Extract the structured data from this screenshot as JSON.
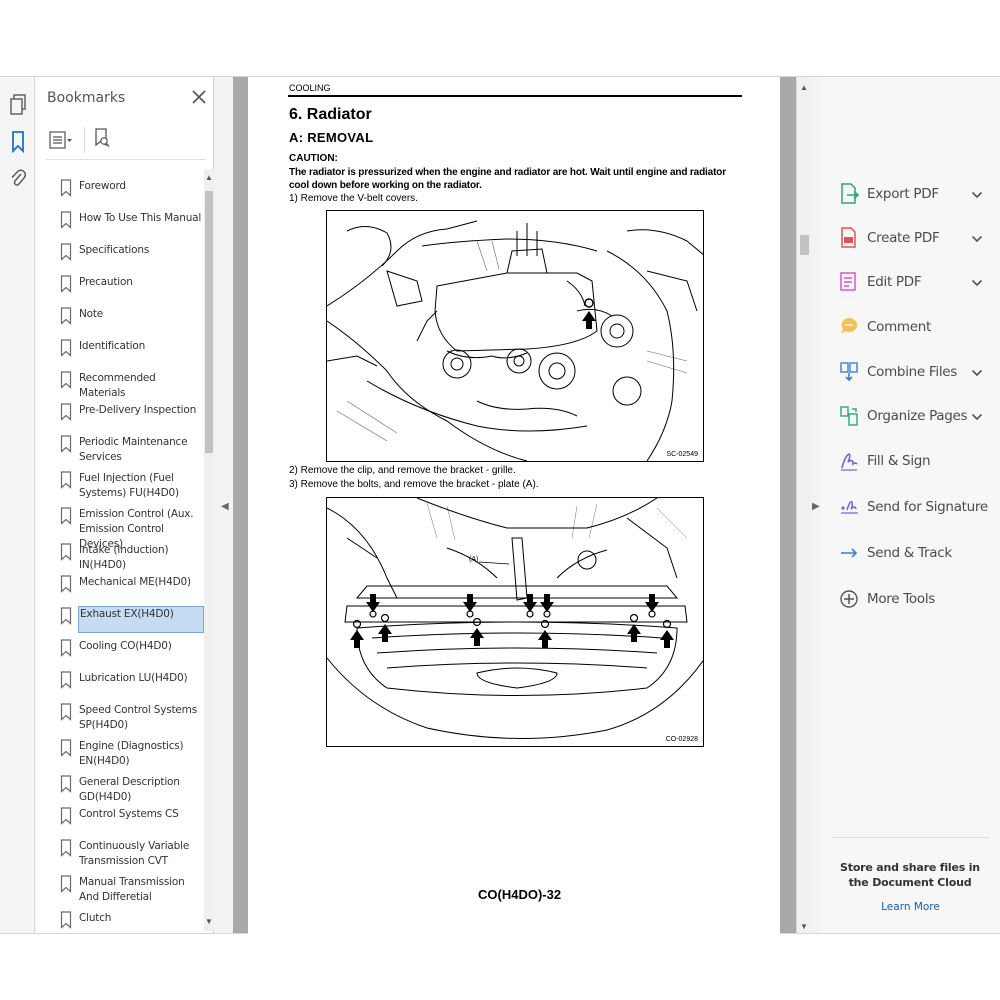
{
  "bookmarks_panel": {
    "title": "Bookmarks",
    "items": [
      {
        "label": "Foreword",
        "selected": false
      },
      {
        "label": "How To Use This Manual",
        "selected": false
      },
      {
        "label": "Specifications",
        "selected": false
      },
      {
        "label": "Precaution",
        "selected": false
      },
      {
        "label": "Note",
        "selected": false
      },
      {
        "label": "Identification",
        "selected": false
      },
      {
        "label": "Recommended Materials",
        "selected": false
      },
      {
        "label": "Pre-Delivery Inspection",
        "selected": false
      },
      {
        "label": "Periodic Maintenance Services",
        "selected": false
      },
      {
        "label": "Fuel Injection (Fuel Systems) FU(H4D0)",
        "selected": false
      },
      {
        "label": "Emission Control (Aux. Emission Control Devices)",
        "selected": false
      },
      {
        "label": "Intake (Induction) IN(H4D0)",
        "selected": false
      },
      {
        "label": "Mechanical ME(H4D0)",
        "selected": false
      },
      {
        "label": "Exhaust EX(H4D0)",
        "selected": true
      },
      {
        "label": "Cooling CO(H4D0)",
        "selected": false
      },
      {
        "label": "Lubrication LU(H4D0)",
        "selected": false
      },
      {
        "label": "Speed Control Systems SP(H4D0)",
        "selected": false
      },
      {
        "label": "Engine (Diagnostics) EN(H4D0)",
        "selected": false
      },
      {
        "label": "General Description GD(H4D0)",
        "selected": false
      },
      {
        "label": "Control Systems CS",
        "selected": false
      },
      {
        "label": "Continuously Variable Transmission CVT",
        "selected": false
      },
      {
        "label": "Manual Transmission And Differetial",
        "selected": false
      },
      {
        "label": "Clutch",
        "selected": false
      }
    ]
  },
  "document": {
    "section": "COOLING",
    "heading": "6.  Radiator",
    "subheading": "A:  REMOVAL",
    "caution_title": "CAUTION:",
    "caution_text": "The radiator is pressurized when the engine and radiator are hot. Wait until engine and radiator cool down before working on the radiator.",
    "step1": "1) Remove the V-belt covers.",
    "figure1_code": "SC-02549",
    "step2": "2) Remove the clip, and remove the bracket - grille.",
    "step3": "3) Remove the bolts, and remove the bracket - plate (A).",
    "figure2_code": "CO-02928",
    "figure2_callout": "(A)",
    "page_number": "CO(H4DO)-32"
  },
  "tools_panel": {
    "items": [
      {
        "label": "Export PDF",
        "icon": "export-pdf-icon",
        "has_chevron": true,
        "color": "#2ea67a"
      },
      {
        "label": "Create PDF",
        "icon": "create-pdf-icon",
        "has_chevron": true,
        "color": "#e2554f"
      },
      {
        "label": "Edit PDF",
        "icon": "edit-pdf-icon",
        "has_chevron": true,
        "color": "#e055c9"
      },
      {
        "label": "Comment",
        "icon": "comment-icon",
        "has_chevron": false,
        "color": "#f2b53a"
      },
      {
        "label": "Combine Files",
        "icon": "combine-files-icon",
        "has_chevron": true,
        "color": "#3a7fd6"
      },
      {
        "label": "Organize Pages",
        "icon": "organize-pages-icon",
        "has_chevron": true,
        "color": "#2ea67a"
      },
      {
        "label": "Fill & Sign",
        "icon": "fill-sign-icon",
        "has_chevron": false,
        "color": "#7a63d6"
      },
      {
        "label": "Send for Signature",
        "icon": "send-signature-icon",
        "has_chevron": false,
        "color": "#7a63d6"
      },
      {
        "label": "Send & Track",
        "icon": "send-track-icon",
        "has_chevron": false,
        "color": "#3a7fd6"
      },
      {
        "label": "More Tools",
        "icon": "more-tools-icon",
        "has_chevron": false,
        "color": "#555555"
      }
    ],
    "cloud_text": "Store and share files in the Document Cloud",
    "cloud_link": "Learn More"
  }
}
